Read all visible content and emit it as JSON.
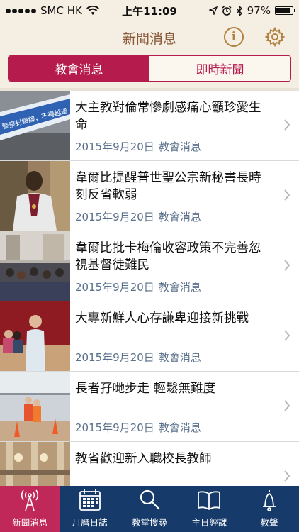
{
  "status_bar": {
    "carrier": "SMC HK",
    "time": "上午11:09",
    "battery": "97%",
    "battery_level": 0.97
  },
  "header": {
    "title": "新聞消息",
    "info_icon": "info-icon",
    "settings_icon": "gear-icon",
    "accent_color": "#b51c4d"
  },
  "segments": [
    {
      "label": "教會消息",
      "selected": true
    },
    {
      "label": "即時新聞",
      "selected": false
    }
  ],
  "news": [
    {
      "title": "大主教對倫常慘劇感痛心籲珍愛生命",
      "date": "2015年9月20日",
      "category": "教會消息",
      "thumbnail_text": "警察封鎖線，不得越過"
    },
    {
      "title": "韋爾比提醒普世聖公宗新秘書長時刻反省軟弱",
      "date": "2015年9月20日",
      "category": "教會消息"
    },
    {
      "title": "韋爾比批卡梅倫收容政策不完善忽視基督徒難民",
      "date": "2015年9月20日",
      "category": "教會消息"
    },
    {
      "title": "大專新鮮人心存謙卑迎接新挑戰",
      "date": "2015年9月20日",
      "category": "教會消息"
    },
    {
      "title": "長者孖哋步走 輕鬆無難度",
      "date": "2015年9月20日",
      "category": "教會消息"
    },
    {
      "title": "教省歡迎新入職校長教師",
      "date": "",
      "category": ""
    }
  ],
  "tabs": [
    {
      "label": "新聞消息",
      "icon": "broadcast-tower-icon",
      "active": true
    },
    {
      "label": "月曆日誌",
      "icon": "calendar-icon",
      "active": false
    },
    {
      "label": "教堂搜尋",
      "icon": "search-icon",
      "active": false
    },
    {
      "label": "主日經課",
      "icon": "book-icon",
      "active": false
    },
    {
      "label": "教聲",
      "icon": "bell-icon",
      "active": false
    }
  ]
}
